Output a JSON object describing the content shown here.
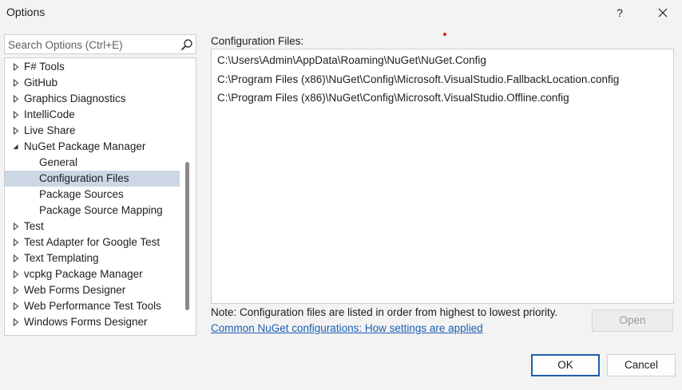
{
  "window": {
    "title": "Options",
    "help": "?",
    "close_icon": "close-icon"
  },
  "search": {
    "placeholder": "Search Options (Ctrl+E)",
    "value": "",
    "icon": "search-icon"
  },
  "tree": {
    "items": [
      {
        "label": "F# Tools",
        "level": 0,
        "state": "collapsed"
      },
      {
        "label": "GitHub",
        "level": 0,
        "state": "collapsed"
      },
      {
        "label": "Graphics Diagnostics",
        "level": 0,
        "state": "collapsed"
      },
      {
        "label": "IntelliCode",
        "level": 0,
        "state": "collapsed"
      },
      {
        "label": "Live Share",
        "level": 0,
        "state": "collapsed"
      },
      {
        "label": "NuGet Package Manager",
        "level": 0,
        "state": "expanded"
      },
      {
        "label": "General",
        "level": 1,
        "state": "leaf"
      },
      {
        "label": "Configuration Files",
        "level": 1,
        "state": "leaf",
        "selected": true
      },
      {
        "label": "Package Sources",
        "level": 1,
        "state": "leaf"
      },
      {
        "label": "Package Source Mapping",
        "level": 1,
        "state": "leaf"
      },
      {
        "label": "Test",
        "level": 0,
        "state": "collapsed"
      },
      {
        "label": "Test Adapter for Google Test",
        "level": 0,
        "state": "collapsed"
      },
      {
        "label": "Text Templating",
        "level": 0,
        "state": "collapsed"
      },
      {
        "label": "vcpkg Package Manager",
        "level": 0,
        "state": "collapsed"
      },
      {
        "label": "Web Forms Designer",
        "level": 0,
        "state": "collapsed"
      },
      {
        "label": "Web Performance Test Tools",
        "level": 0,
        "state": "collapsed"
      },
      {
        "label": "Windows Forms Designer",
        "level": 0,
        "state": "collapsed"
      }
    ]
  },
  "config": {
    "label": "Configuration Files:",
    "files": [
      "C:\\Users\\Admin\\AppData\\Roaming\\NuGet\\NuGet.Config",
      "C:\\Program Files (x86)\\NuGet\\Config\\Microsoft.VisualStudio.FallbackLocation.config",
      "C:\\Program Files (x86)\\NuGet\\Config\\Microsoft.VisualStudio.Offline.config"
    ],
    "note": "Note: Configuration files are listed in order from highest to lowest priority.",
    "link": "Common NuGet configurations: How settings are applied",
    "open_label": "Open"
  },
  "buttons": {
    "ok": "OK",
    "cancel": "Cancel"
  },
  "colors": {
    "selection": "#ccd6e4",
    "link": "#1a5fb4",
    "accent_border": "#1f5fa8"
  }
}
